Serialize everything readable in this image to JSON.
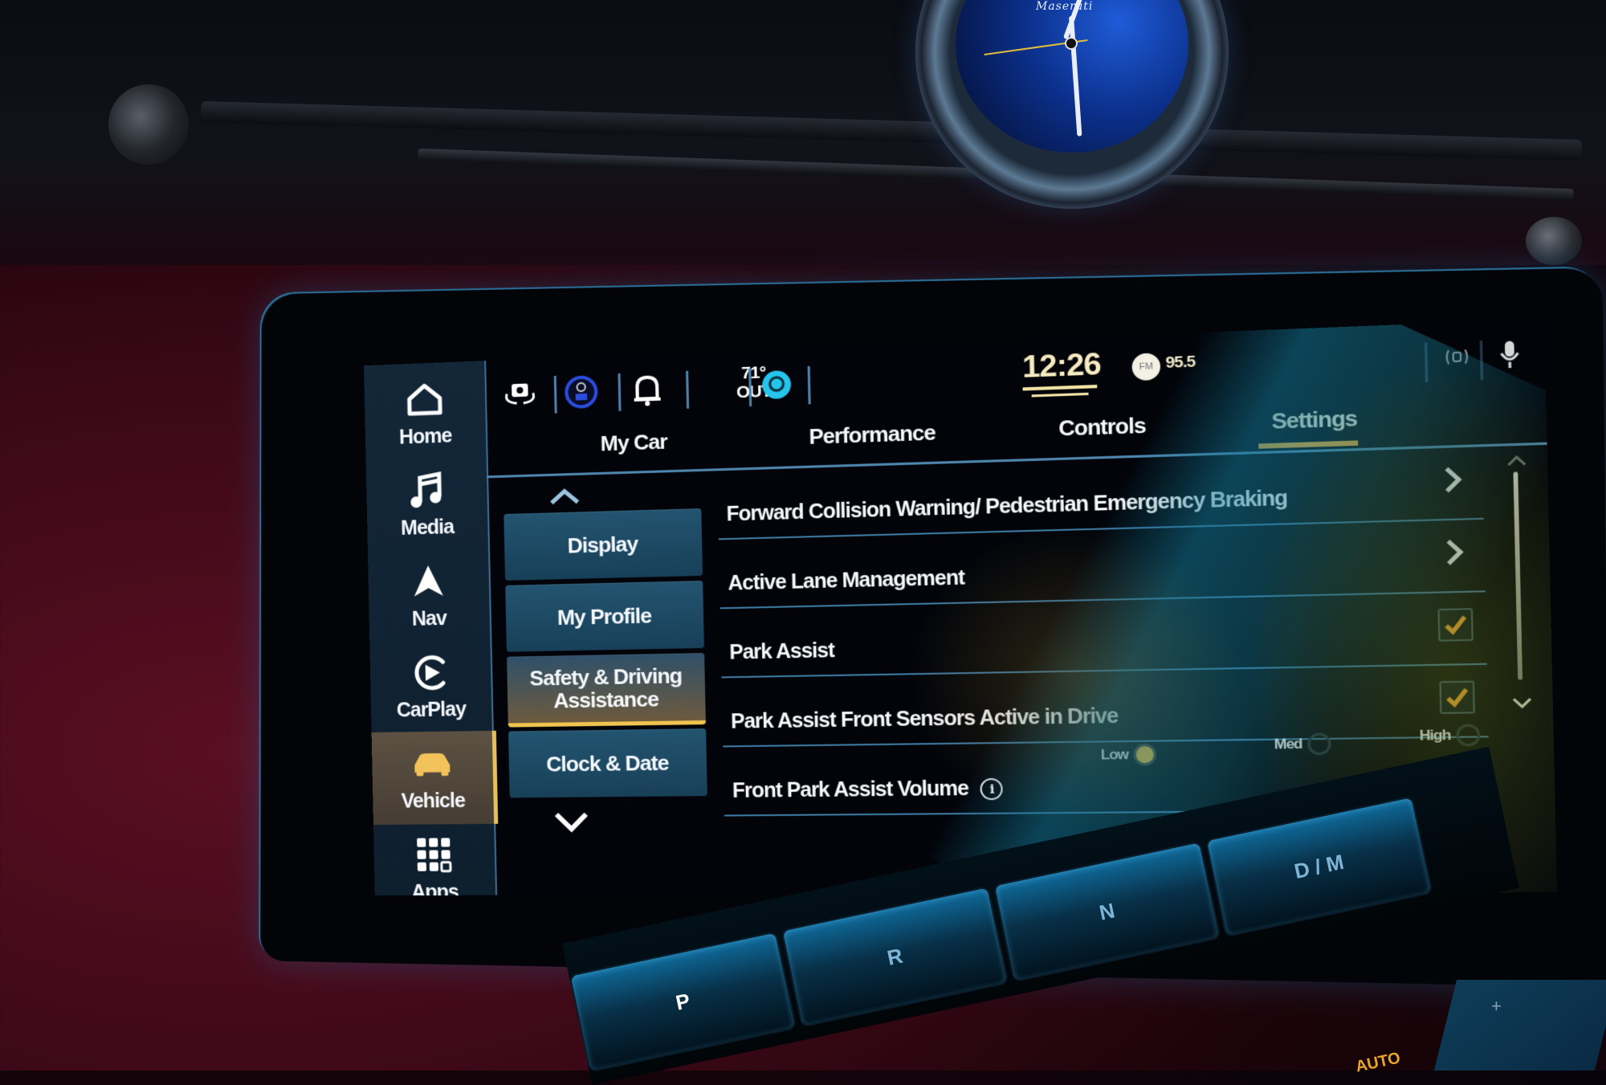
{
  "environment": {
    "clock_brand": "Maserati"
  },
  "sidebar": {
    "items": [
      {
        "label": "Home",
        "icon": "home-icon",
        "active": false
      },
      {
        "label": "Media",
        "icon": "music-note-icon",
        "active": false
      },
      {
        "label": "Nav",
        "icon": "navigation-arrow-icon",
        "active": false
      },
      {
        "label": "CarPlay",
        "icon": "carplay-icon",
        "active": false
      },
      {
        "label": "Vehicle",
        "icon": "car-icon",
        "active": true
      },
      {
        "label": "Apps",
        "icon": "apps-grid-icon",
        "active": false
      }
    ]
  },
  "status_bar": {
    "icons": [
      "camera-rotate-icon",
      "driver-assist-icon",
      "bell-icon"
    ],
    "temperature": "71°",
    "temperature_label": "OUT",
    "assistant_icon": "alexa-icon",
    "time": "12:26",
    "radio_band": "FM",
    "radio_frequency": "95.5",
    "right_icons": [
      "signal-icon",
      "microphone-icon"
    ]
  },
  "tabs": [
    {
      "label": "My Car",
      "active": false
    },
    {
      "label": "Performance",
      "active": false
    },
    {
      "label": "Controls",
      "active": false
    },
    {
      "label": "Settings",
      "active": true
    }
  ],
  "categories": [
    {
      "label": "Display",
      "active": false
    },
    {
      "label": "My Profile",
      "active": false
    },
    {
      "label": "Safety & Driving Assistance",
      "active": true
    },
    {
      "label": "Clock & Date",
      "active": false
    }
  ],
  "settings": [
    {
      "label": "Forward Collision Warning/ Pedestrian Emergency Braking",
      "control": "chevron"
    },
    {
      "label": "Active Lane Management",
      "control": "chevron"
    },
    {
      "label": "Park Assist",
      "control": "checkbox",
      "checked": true
    },
    {
      "label": "Park Assist Front Sensors Active in Drive",
      "control": "checkbox",
      "checked": true
    },
    {
      "label": "Front Park Assist Volume",
      "control": "radio",
      "info": true,
      "options": [
        "Low",
        "Med",
        "High"
      ],
      "selected": "Low"
    }
  ],
  "gear_selector": {
    "buttons": [
      "P",
      "R",
      "N",
      "D / M"
    ],
    "auto_label": "AUTO"
  },
  "colors": {
    "accent": "#efa52e",
    "active_tab_indicator": "#efa52e",
    "sidebar_active": "#f2c35a",
    "divider": "#3f7aa4"
  }
}
